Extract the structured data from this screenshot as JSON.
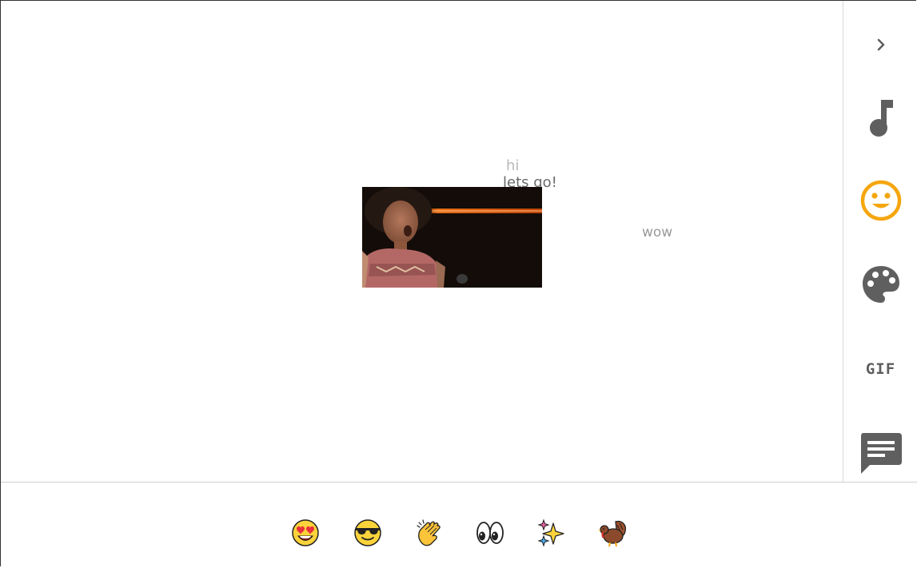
{
  "messages": {
    "hi": "hi",
    "lets_go": "lets go!",
    "wow": "wow"
  },
  "sidebar": {
    "items": [
      {
        "name": "collapse",
        "icon": "chevron-right-icon"
      },
      {
        "name": "music",
        "icon": "music-note-icon"
      },
      {
        "name": "emoji",
        "icon": "smiley-icon",
        "active": true,
        "color": "#f5a60f"
      },
      {
        "name": "theme",
        "icon": "palette-icon"
      },
      {
        "name": "gif",
        "icon": "gif-icon",
        "label": "GIF"
      },
      {
        "name": "chat",
        "icon": "chat-bubble-icon"
      }
    ],
    "icon_color": "#5f5f5f"
  },
  "gif_content": {
    "icon": "animated-gif-image"
  },
  "emoji_bar": {
    "items": [
      {
        "name": "heart-eyes",
        "icon": "heart-eyes-emoji-icon"
      },
      {
        "name": "sunglasses",
        "icon": "sunglasses-emoji-icon"
      },
      {
        "name": "clap",
        "icon": "clapping-hands-emoji-icon"
      },
      {
        "name": "eyes",
        "icon": "eyes-emoji-icon"
      },
      {
        "name": "sparkles",
        "icon": "sparkles-emoji-icon"
      },
      {
        "name": "turkey",
        "icon": "turkey-emoji-icon"
      }
    ]
  }
}
